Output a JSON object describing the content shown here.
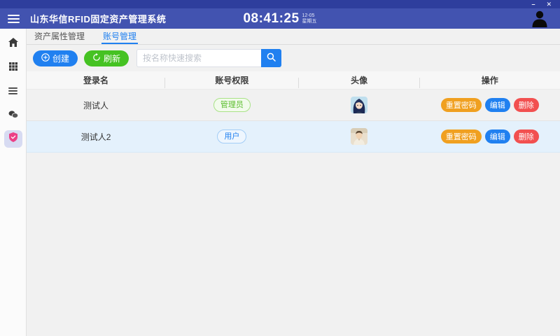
{
  "window": {
    "minimize_label": "–",
    "close_label": "✕"
  },
  "appbar": {
    "title": "山东华信RFID固定资产管理系统",
    "clock_time": "08:41:25",
    "clock_date": "12-05",
    "clock_weekday": "星期五",
    "icons": [
      "hamburger-menu-icon",
      "user-avatar-icon"
    ]
  },
  "sidebar": {
    "icons": [
      "home-icon",
      "apps-grid-icon",
      "list-icon",
      "coins-icon",
      "shield-icon"
    ],
    "active_index": 4
  },
  "tabs": [
    {
      "label": "资产属性管理",
      "active": false
    },
    {
      "label": "账号管理",
      "active": true
    }
  ],
  "toolbar": {
    "create_label": "创建",
    "refresh_label": "刷新",
    "search_placeholder": "按名称快速搜索",
    "icons": [
      "circle-plus-icon",
      "refresh-icon",
      "search-icon"
    ]
  },
  "table": {
    "headers": [
      "登录名",
      "账号权限",
      "头像",
      "操作"
    ],
    "rows": [
      {
        "login": "测试人",
        "role": "管理员",
        "role_style": "green",
        "avatar": "blue-haired-girl-avatar",
        "selected": false,
        "actions": {
          "reset": "重置密码",
          "edit": "编辑",
          "delete": "删除"
        }
      },
      {
        "login": "测试人2",
        "role": "用户",
        "role_style": "blue",
        "avatar": "portrait-avatar",
        "selected": true,
        "actions": {
          "reset": "重置密码",
          "edit": "编辑",
          "delete": "删除"
        }
      }
    ]
  },
  "colors": {
    "titlebar": "#2e3e9d",
    "appbar": "#4253b0",
    "primary_blue": "#2080f0",
    "success_green": "#45c222",
    "warning_orange": "#f0a020",
    "danger_red": "#f25050",
    "selected_row": "#e4f1fc",
    "active_shield_pink": "#ec3f86",
    "page_background": "#f1f1f1"
  }
}
